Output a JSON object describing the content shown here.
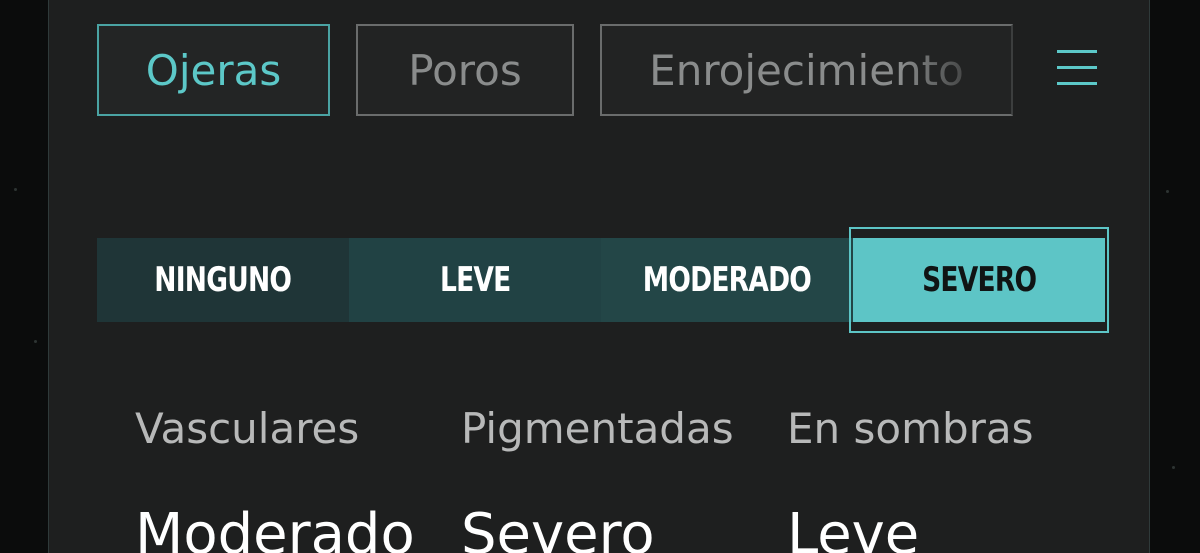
{
  "tabs": [
    {
      "label": "Ojeras",
      "active": true
    },
    {
      "label": "Poros",
      "active": false
    },
    {
      "label": "Enrojecimiento",
      "active": false
    }
  ],
  "menu": {
    "icon": "hamburger-menu-icon"
  },
  "severity": {
    "options": [
      "NINGUNO",
      "LEVE",
      "MODERADO",
      "SEVERO"
    ],
    "selected": "SEVERO"
  },
  "results": [
    {
      "label": "Vasculares",
      "value": "Moderado"
    },
    {
      "label": "Pigmentadas",
      "value": "Severo"
    },
    {
      "label": "En sombras",
      "value": "Leve"
    }
  ],
  "colors": {
    "accent": "#5dc5c6",
    "panel": "#1e1f1f",
    "background": "#0b0c0c"
  }
}
